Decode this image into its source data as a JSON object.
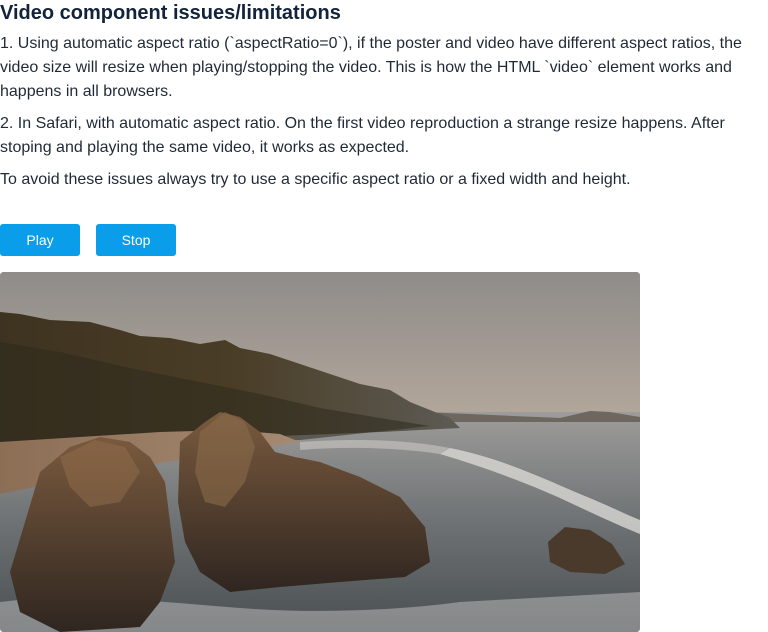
{
  "heading": "Video component issues/limitations",
  "paragraphs": [
    "1. Using automatic aspect ratio (`aspectRatio=0`), if the poster and video have different aspect ratios, the video size will resize when playing/stopping the video. This is how the HTML `video` element works and happens in all browsers.",
    "2. In Safari, with automatic aspect ratio. On the first video reproduction a strange resize happens. After stoping and playing the same video, it works as expected.",
    "To avoid these issues always try to use a specific aspect ratio or a fixed width and height."
  ],
  "controls": {
    "play_label": "Play",
    "stop_label": "Stop"
  },
  "video": {
    "poster_subject": "coastline-sunset"
  },
  "colors": {
    "button": "#0a9dea",
    "heading": "#13233a"
  }
}
